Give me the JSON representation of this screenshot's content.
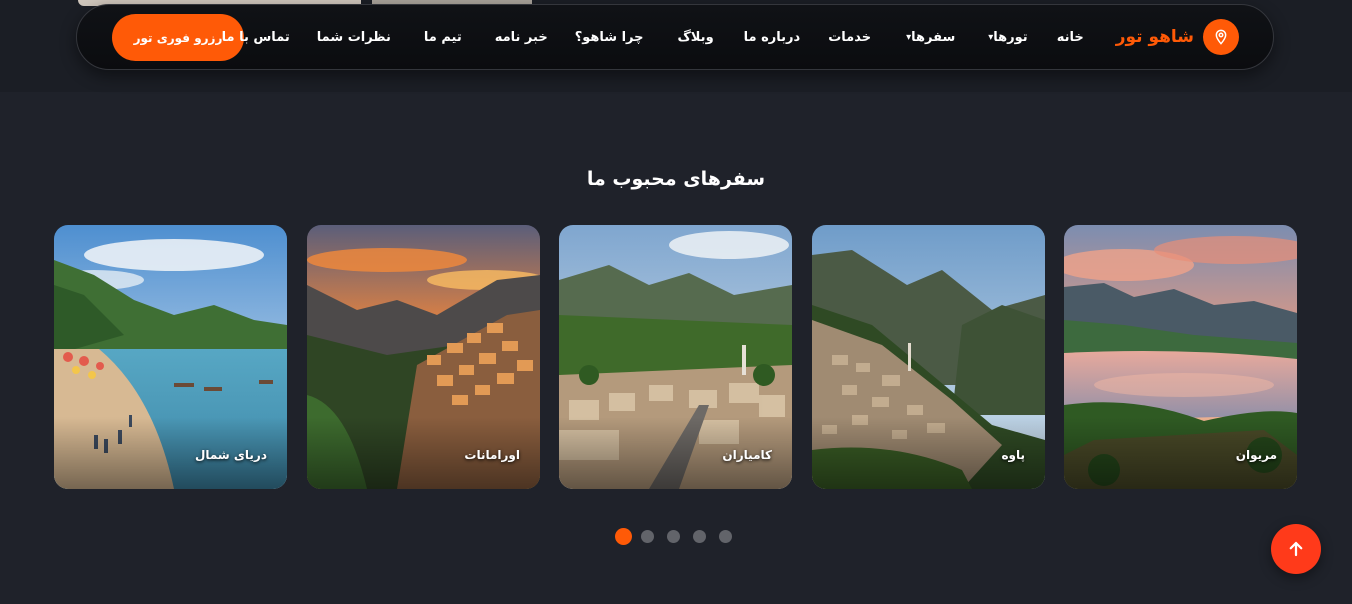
{
  "header": {
    "brand": "شاهو تور",
    "brand_icon": "location-pin-icon",
    "cta_label": "رزرو فوری تور",
    "nav": [
      {
        "label": "خانه",
        "dropdown": false
      },
      {
        "label": "تورها",
        "dropdown": true
      },
      {
        "label": "سفرها",
        "dropdown": true
      },
      {
        "label": "خدمات",
        "dropdown": false
      },
      {
        "label": "درباره ما",
        "dropdown": false
      },
      {
        "label": "وبلاگ",
        "dropdown": false
      },
      {
        "label": "چرا شاهو؟",
        "dropdown": false
      },
      {
        "label": "خبر نامه",
        "dropdown": false
      },
      {
        "label": "تیم ما",
        "dropdown": false
      },
      {
        "label": "نظرات شما",
        "dropdown": false
      },
      {
        "label": "تماس با ما",
        "dropdown": false
      }
    ],
    "dropdown_glyph": "▾"
  },
  "section": {
    "title": "سفرهای محبوب ما"
  },
  "destinations": [
    {
      "label": "مریوان",
      "scene": "lake-sunset"
    },
    {
      "label": "پاوه",
      "scene": "mountain-village"
    },
    {
      "label": "کامیاران",
      "scene": "valley-town"
    },
    {
      "label": "اورامانات",
      "scene": "terraced-village-sunset"
    },
    {
      "label": "دریای شمال",
      "scene": "beach"
    }
  ],
  "carousel": {
    "dots": 5,
    "active_dot": 0
  },
  "scroll_top": {
    "icon": "arrow-up-icon"
  },
  "colors": {
    "accent": "#ff5a07",
    "scroll_button": "#ff3a1a",
    "background": "#1f222a",
    "navbar": "#0e0f12",
    "dot_inactive": "#62646a"
  }
}
